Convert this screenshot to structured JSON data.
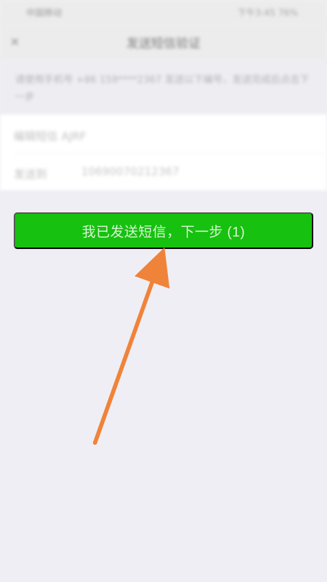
{
  "status_bar": {
    "carrier": "中国移动",
    "right": "下午3:45 76%"
  },
  "nav": {
    "back": "×",
    "title": "发送短信验证"
  },
  "notice": "请使用手机号 +86 159****2367 发送以下编号，发送完成后点击下一步",
  "form": {
    "row1": "编辑短信 AJRF",
    "row2_label": "发送到",
    "row2_value": "10690070212367"
  },
  "button": {
    "label": "我已发送短信，下一步 (1)"
  },
  "colors": {
    "primary": "#16c110",
    "arrow": "#f0833a",
    "page_bg": "#efeef4"
  }
}
